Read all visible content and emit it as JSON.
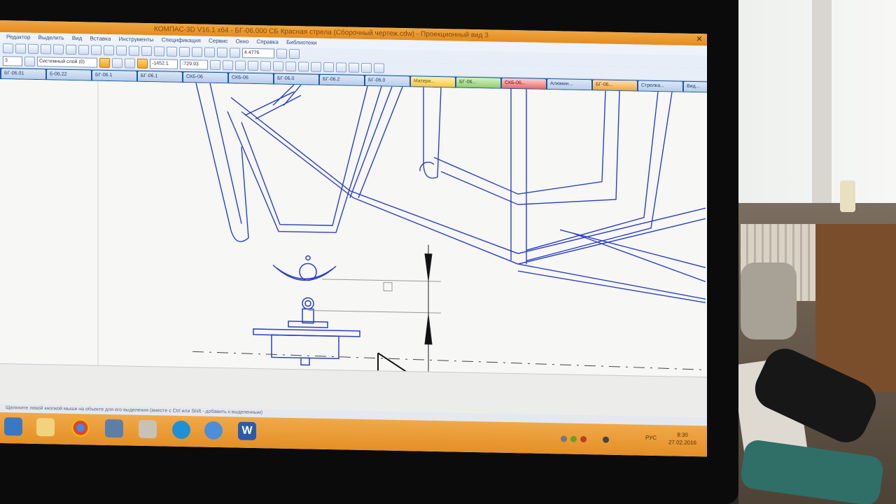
{
  "window": {
    "title": "КОМПАС-3D V16.1 x64 - БГ-06.000 СБ Красная стрела (Сборочный чертеж.cdw) - Проекционный вид 3",
    "close_glyph": "✕"
  },
  "menu": {
    "items": [
      "Редактор",
      "Выделить",
      "Вид",
      "Вставка",
      "Инструменты",
      "Спецификация",
      "Сервис",
      "Окно",
      "Справка",
      "Библиотеки"
    ]
  },
  "toolbar": {
    "zoom_value": "4.4776",
    "layer_value": "Системный слой (0)",
    "coord_x": "-1452.1",
    "coord_y": "-729.93",
    "style_field": "3"
  },
  "tabs": [
    {
      "label": "БГ-06.01",
      "style": "normal"
    },
    {
      "label": "Б-06.22",
      "style": "normal"
    },
    {
      "label": "БГ-06.1",
      "style": "normal"
    },
    {
      "label": "БГ-06.1",
      "style": "normal"
    },
    {
      "label": "СКБ-06",
      "style": "normal"
    },
    {
      "label": "СКБ-06",
      "style": "normal"
    },
    {
      "label": "БГ-06.0",
      "style": "normal"
    },
    {
      "label": "БГ-06.2",
      "style": "normal"
    },
    {
      "label": "БГ-06.0",
      "style": "normal"
    },
    {
      "label": "Матери...",
      "style": "active-y"
    },
    {
      "label": "БГ-06...",
      "style": "green"
    },
    {
      "label": "СКБ-06...",
      "style": "red"
    },
    {
      "label": "Алюмин...",
      "style": "normal"
    },
    {
      "label": "БГ-06...",
      "style": "orange"
    },
    {
      "label": "Стрелка...",
      "style": "normal"
    },
    {
      "label": "Вид...",
      "style": "normal"
    }
  ],
  "status": {
    "hint": "Щелкните левой кнопкой мыши на объекте для его выделения (вместе с Ctrl или Shift - добавить к выделенным)"
  },
  "taskbar": {
    "language": "РУС",
    "time": "8:30",
    "date": "27.02.2016",
    "word_label": "W"
  },
  "colors": {
    "drawing_line": "#2b3fc9",
    "taskbar": "#e48f26",
    "titlebar": "#f0a640"
  }
}
